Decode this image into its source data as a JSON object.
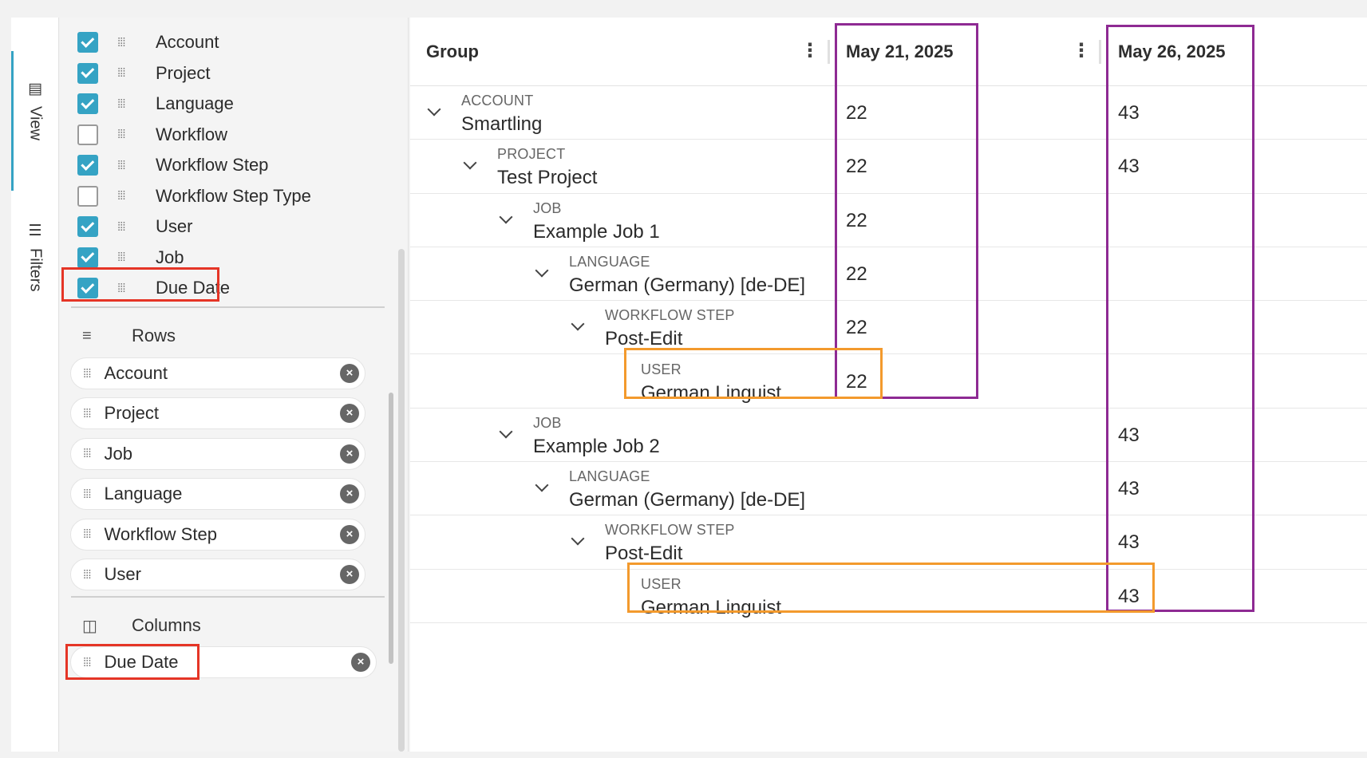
{
  "tabs": {
    "view_label": "View",
    "filters_label": "Filters",
    "view_icon": "table-icon",
    "filters_icon": "menu-icon"
  },
  "fields": [
    {
      "label": "Account",
      "checked": true
    },
    {
      "label": "Project",
      "checked": true
    },
    {
      "label": "Language",
      "checked": true
    },
    {
      "label": "Workflow",
      "checked": false
    },
    {
      "label": "Workflow Step",
      "checked": true
    },
    {
      "label": "Workflow Step Type",
      "checked": false
    },
    {
      "label": "User",
      "checked": true
    },
    {
      "label": "Job",
      "checked": true
    },
    {
      "label": "Due Date",
      "checked": true
    }
  ],
  "rows_section": {
    "title": "Rows",
    "items": [
      "Account",
      "Project",
      "Job",
      "Language",
      "Workflow Step",
      "User"
    ]
  },
  "columns_section": {
    "title": "Columns",
    "items": [
      "Due Date"
    ]
  },
  "table": {
    "header": {
      "group": "Group",
      "col1": "May 21, 2025",
      "col2": "May 26, 2025"
    },
    "rows": [
      {
        "category": "ACCOUNT",
        "value": "Smartling",
        "c1": "22",
        "c2": "43",
        "expandable": true
      },
      {
        "category": "PROJECT",
        "value": "Test Project",
        "c1": "22",
        "c2": "43",
        "expandable": true
      },
      {
        "category": "JOB",
        "value": "Example Job 1",
        "c1": "22",
        "c2": "",
        "expandable": true
      },
      {
        "category": "LANGUAGE",
        "value": "German (Germany) [de-DE]",
        "c1": "22",
        "c2": "",
        "expandable": true
      },
      {
        "category": "WORKFLOW STEP",
        "value": "Post-Edit",
        "c1": "22",
        "c2": "",
        "expandable": true
      },
      {
        "category": "USER",
        "value": "German Linguist",
        "c1": "22",
        "c2": "",
        "expandable": false
      },
      {
        "category": "JOB",
        "value": "Example Job 2",
        "c1": "",
        "c2": "43",
        "expandable": true
      },
      {
        "category": "LANGUAGE",
        "value": "German (Germany) [de-DE]",
        "c1": "",
        "c2": "43",
        "expandable": true
      },
      {
        "category": "WORKFLOW STEP",
        "value": "Post-Edit",
        "c1": "",
        "c2": "43",
        "expandable": true
      },
      {
        "category": "USER",
        "value": "German Linguist",
        "c1": "",
        "c2": "43",
        "expandable": false
      }
    ]
  },
  "colors": {
    "accent": "#35a3c4",
    "highlight_red": "#e53526",
    "highlight_purple": "#8e2a93",
    "highlight_orange": "#f39a2d"
  }
}
